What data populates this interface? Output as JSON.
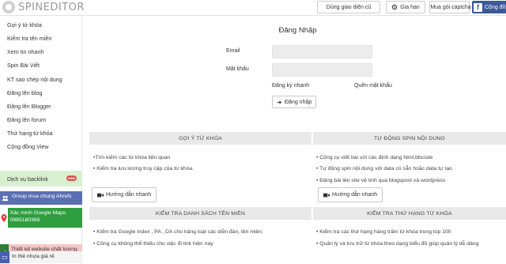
{
  "header": {
    "logo_text": "SPINEDITOR",
    "buttons": {
      "old_ui": "Dùng giao diện cũ",
      "renew": "Gia hạn",
      "buy_captcha": "Mua gói captcha",
      "community": "Cộng đồ"
    }
  },
  "sidebar": {
    "items": [
      "Gợi ý từ khóa",
      "Kiểm tra tên miền",
      "Xem tin nhanh",
      "Spin Bài Viết",
      "KT sao chép nội dung",
      "Đăng lên blog",
      "Đăng lên Blogger",
      "Đăng lên forum",
      "Thứ hạng từ khóa",
      "Cộng đồng View"
    ],
    "backlink": "Dịch vụ backlink",
    "backlink_badge": "new",
    "promos": [
      {
        "text": "Group mua chung Ahrefs",
        "bg": "#5b6fb5",
        "color": "#ffffff",
        "icon": "group-icon"
      },
      {
        "text": "Xác minh Google Maps 0985180365",
        "bg": "#2e9e3e",
        "color": "#ffffff",
        "icon": "map-pin-icon"
      },
      {
        "text": "Thiết kế website chất lượng cao",
        "bg": "#f6c6c6",
        "color": "#333333",
        "icon": "check-icon"
      },
      {
        "text": "In thẻ nhựa giá rẻ",
        "bg": "#f3f3f3",
        "color": "#333333",
        "icon": "card-icon"
      }
    ]
  },
  "login": {
    "title": "Đăng Nhập",
    "email_label": "Email",
    "password_label": "Mật khẩu",
    "register_link": "Đăng ký nhanh",
    "forgot_link": "Quên mật khẩu",
    "submit_label": "Đăng nhập"
  },
  "panels": {
    "keyword": {
      "title": "GỢI Ý TỪ KHÓA",
      "lines": [
        "•Tìm kiếm các từ khóa liên quan",
        "• Kiểm tra lưu lượng truy cập của từ khóa."
      ],
      "guide": "Hướng dẫn nhanh"
    },
    "spin": {
      "title": "TỰ ĐỘNG SPIN NỘI DUNG",
      "lines": [
        "• Công cụ viết bài với các định dạng html,bbcode",
        "• Tự động spin nội dung với data có sẵn hoặc data tự tạo",
        "• Đăng bài lên site vệ tinh qua blogspost và wordpress"
      ],
      "guide": "Hướng dẫn nhanh"
    },
    "domain": {
      "title": "KIỂM TRA DANH SÁCH TÊN MIỀN",
      "lines": [
        "• Kiểm tra Google index , PA , DA cho hàng loạt các diễn đàn, tên miền.",
        "• Công cụ không thể thiếu cho việc đi link hiện nay"
      ]
    },
    "rank": {
      "title": "KIỂM TRA THỨ HẠNG TỪ KHÓA",
      "lines": [
        "• Kiểm tra các thứ hạng hàng trăm từ khóa trong top 100",
        "• Quản lý và lưu trữ từ khóa theo dạng biểu đồ giúp quản lý dễ dàng"
      ]
    }
  }
}
